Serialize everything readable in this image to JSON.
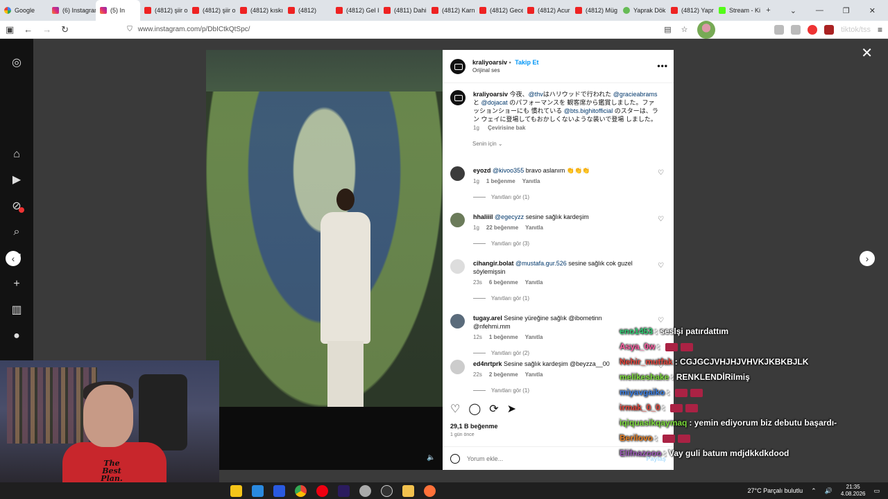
{
  "browser": {
    "tabs": [
      {
        "label": "Google",
        "icon": "google-icon"
      },
      {
        "label": "(6) Instagram",
        "icon": "instagram-icon"
      },
      {
        "label": "(5) In",
        "icon": "instagram-icon",
        "active": true
      },
      {
        "label": "(4812) şiir o",
        "icon": "youtube-icon"
      },
      {
        "label": "(4812) şiir o",
        "icon": "youtube-icon"
      },
      {
        "label": "(4812) kıskı",
        "icon": "youtube-icon"
      },
      {
        "label": "(4812)",
        "icon": "youtube-icon"
      },
      {
        "label": "(4812) Gel I",
        "icon": "youtube-icon"
      },
      {
        "label": "(4811) Dahi",
        "icon": "youtube-icon"
      },
      {
        "label": "(4812) Karn",
        "icon": "youtube-icon"
      },
      {
        "label": "(4812) Gece",
        "icon": "youtube-icon"
      },
      {
        "label": "(4812) Acur",
        "icon": "youtube-icon"
      },
      {
        "label": "(4812) Müg",
        "icon": "youtube-icon"
      },
      {
        "label": "Yaprak Dök",
        "icon": "leaf-icon"
      },
      {
        "label": "(4812) Yapr",
        "icon": "youtube-icon"
      },
      {
        "label": "Stream - Ki",
        "icon": "kick-icon"
      }
    ],
    "url": "www.instagram.com/p/DbICtkQtSpc/",
    "watermark": "tiktok/tss"
  },
  "post": {
    "username": "kraliyoarsiv",
    "follow_label": "Takip Et",
    "audio": "Orijinal ses",
    "caption_user": "kraliyoarsiv",
    "caption_parts": [
      "今夜、",
      "@thv",
      "はハリウッドで行われた ",
      "@gracieabrams",
      " と ",
      "@dojacat",
      " のパフォーマンスを 観客席から鑑賞しました。ファッションショーにも 慣れている ",
      "@bts.bighitofficial",
      " のスターは、ラン ウェイに登場してもおかしくないような装いで登場 しました。"
    ],
    "caption_time": "1g",
    "see_translation": "Çevirisine bak",
    "sort_label": "Senin için",
    "comments": [
      {
        "user": "eyozd",
        "mention": "@kivoo355",
        "text": "bravo aslanım 👏👏👏",
        "time": "1g",
        "likes": "1 beğenme",
        "reply": "Yanıtla",
        "view_replies": "Yanıtları gör (1)"
      },
      {
        "user": "hhaliiil",
        "mention": "@egecyzz",
        "text": "sesine sağlık kardeşim",
        "time": "1g",
        "likes": "22 beğenme",
        "reply": "Yanıtla",
        "view_replies": "Yanıtları gör (3)"
      },
      {
        "user": "cihangir.bolat",
        "mention": "@mustafa.gur.526",
        "text": "sesine sağlık cok guzel söylemişsin",
        "time": "23s",
        "likes": "6 beğenme",
        "reply": "Yanıtla",
        "view_replies": "Yanıtları gör (1)"
      },
      {
        "user": "tugay.arel",
        "mention": "",
        "text": "Sesine yüreğine sağlık @ibometinn @nfehmi.mm",
        "time": "12s",
        "likes": "1 beğenme",
        "reply": "Yanıtla",
        "view_replies": "Yanıtları gör (2)"
      },
      {
        "user": "ed4nrtprk",
        "mention": "",
        "text": "Sesine sağlık kardeşim @beyzza__00",
        "time": "22s",
        "likes": "2 beğenme",
        "reply": "Yanıtla",
        "view_replies": "Yanıtları gör (1)"
      }
    ],
    "like_count": "29,1 B beğenme",
    "posted_ago": "1 gün önce",
    "add_comment_placeholder": "Yorum ekle...",
    "post_button": "Paylaş"
  },
  "webcam": {
    "shirt_text": "The Best Plan."
  },
  "chat": [
    {
      "user": "eno1453",
      "msg": "seslşi patırdattım",
      "color": "#2ecc71"
    },
    {
      "user": "Asya_0w",
      "msg": "",
      "color": "#ff5da2",
      "emote": true
    },
    {
      "user": "Nehir_mutfak",
      "msg": "CGJGCJVHJHJVHVKJKBKBJLK",
      "color": "#e0443a"
    },
    {
      "user": "melikeshake",
      "msg": "RENKLENDİRilmiş",
      "color": "#7bdc3a"
    },
    {
      "user": "miyavgaiko",
      "msg": "",
      "color": "#3a7de0",
      "emote": true
    },
    {
      "user": "irmak_0_0",
      "msg": "",
      "color": "#e0443a",
      "emote": true
    },
    {
      "user": "iqiquasikqaymaq",
      "msg": "yemin ediyorum biz debutu başardı-",
      "color": "#7bdc3a"
    },
    {
      "user": "Berilovo",
      "msg": "",
      "color": "#e67e22",
      "emote": true
    },
    {
      "user": "Elifnazooo",
      "msg": "Vay guli batum mdjdkkdkdood",
      "color": "#9b59b6"
    }
  ],
  "taskbar": {
    "weather": "27°C  Parçalı bulutlu",
    "time": "21:35",
    "date": "4.08.2026"
  }
}
